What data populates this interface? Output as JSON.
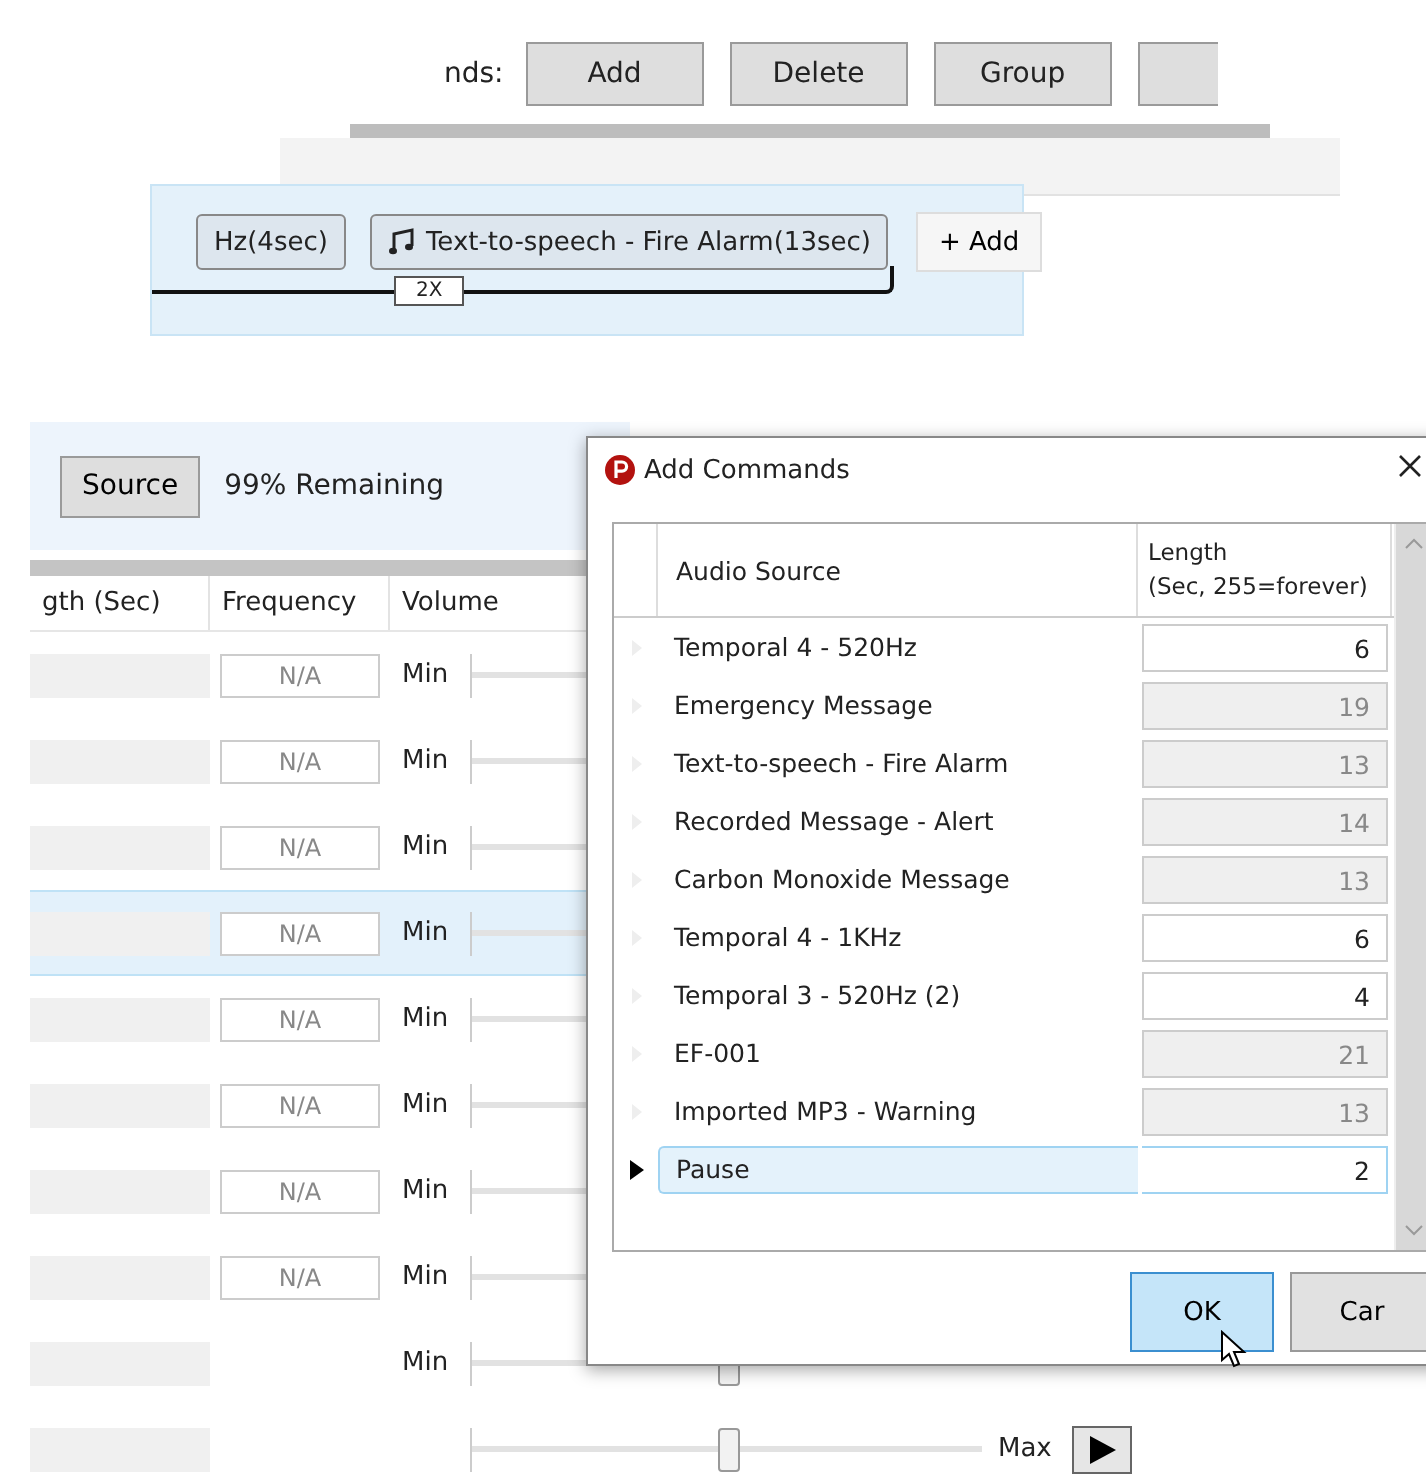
{
  "toolbar": {
    "label": "nds:",
    "buttons": [
      "Add",
      "Delete",
      "Group"
    ]
  },
  "sequence": {
    "steps": [
      {
        "label": "Hz(4sec)",
        "kind": "plain"
      },
      {
        "label": "Text-to-speech - Fire Alarm(13sec)",
        "kind": "music"
      }
    ],
    "repeat": "2X",
    "add_button": "+ Add"
  },
  "source_panel": {
    "source_button": "Source",
    "remaining": "99% Remaining"
  },
  "table": {
    "columns": [
      "gth (Sec)",
      "Frequency",
      "Volume"
    ],
    "rows": [
      {
        "frequency": "N/A",
        "min": "Min",
        "selected": false
      },
      {
        "frequency": "N/A",
        "min": "Min",
        "selected": false
      },
      {
        "frequency": "N/A",
        "min": "Min",
        "selected": false
      },
      {
        "frequency": "N/A",
        "min": "Min",
        "selected": true
      },
      {
        "frequency": "N/A",
        "min": "Min",
        "selected": false
      },
      {
        "frequency": "N/A",
        "min": "Min",
        "selected": false
      },
      {
        "frequency": "N/A",
        "min": "Min",
        "selected": false
      },
      {
        "frequency": "N/A",
        "min": "Min",
        "selected": false
      },
      {
        "min": "Min",
        "level": 0.5,
        "selected": false
      },
      {
        "level": 0.5,
        "max": "Max",
        "selected": false
      }
    ]
  },
  "dialog": {
    "title": "Add Commands",
    "columns": [
      "Audio Source",
      "Length\n(Sec, 255=forever)"
    ],
    "rows": [
      {
        "name": "Temporal 4 - 520Hz",
        "length": "6",
        "editable": true,
        "selected": false
      },
      {
        "name": "Emergency Message",
        "length": "19",
        "editable": false,
        "selected": false
      },
      {
        "name": "Text-to-speech - Fire Alarm",
        "length": "13",
        "editable": false,
        "selected": false
      },
      {
        "name": "Recorded Message - Alert",
        "length": "14",
        "editable": false,
        "selected": false
      },
      {
        "name": "Carbon Monoxide Message",
        "length": "13",
        "editable": false,
        "selected": false
      },
      {
        "name": "Temporal 4 - 1KHz",
        "length": "6",
        "editable": true,
        "selected": false
      },
      {
        "name": "Temporal 3 - 520Hz (2)",
        "length": "4",
        "editable": true,
        "selected": false
      },
      {
        "name": "EF-001",
        "length": "21",
        "editable": false,
        "selected": false
      },
      {
        "name": "Imported MP3 - Warning",
        "length": "13",
        "editable": false,
        "selected": false
      },
      {
        "name": "Pause",
        "length": "2",
        "editable": true,
        "selected": true
      }
    ],
    "buttons": [
      {
        "label": "OK",
        "focused": true
      },
      {
        "label": "Car",
        "focused": false
      }
    ]
  }
}
